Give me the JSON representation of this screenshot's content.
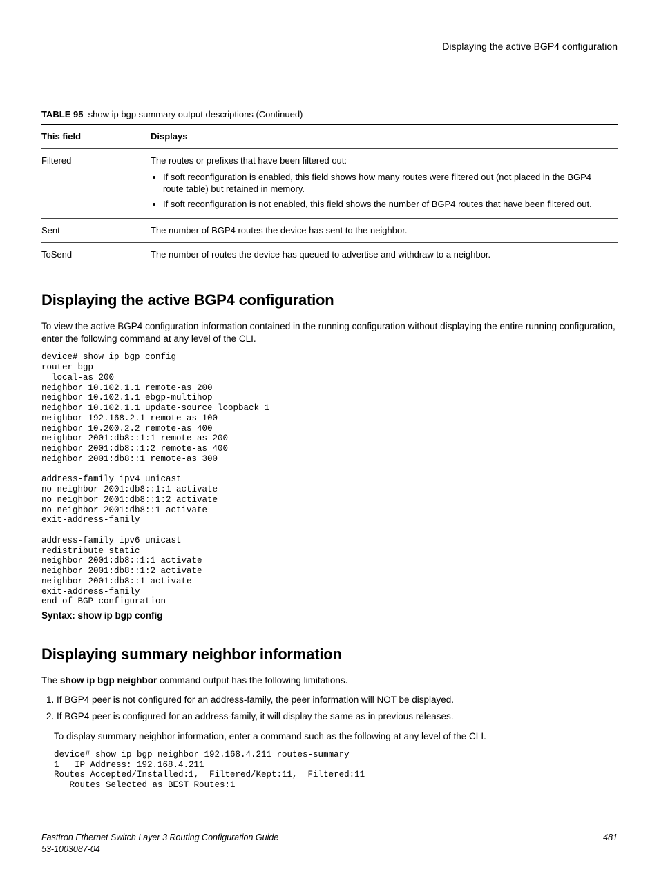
{
  "header": {
    "right": "Displaying the active BGP4 configuration"
  },
  "table": {
    "caption_label": "TABLE 95",
    "caption_text": "show ip bgp summary output descriptions (Continued)",
    "col1": "This field",
    "col2": "Displays",
    "rows": {
      "filtered": {
        "field": "Filtered",
        "intro": "The routes or prefixes that have been filtered out:",
        "b1": "If soft reconfiguration is enabled, this field shows how many routes were filtered out (not placed in the BGP4 route table) but retained in memory.",
        "b2": "If soft reconfiguration is not enabled, this field shows the number of BGP4 routes that have been filtered out."
      },
      "sent": {
        "field": "Sent",
        "desc": "The number of BGP4 routes the device has sent to the neighbor."
      },
      "tosend": {
        "field": "ToSend",
        "desc": "The number of routes the device has queued to advertise and withdraw to a neighbor."
      }
    }
  },
  "section1": {
    "heading": "Displaying the active BGP4 configuration",
    "para": "To view the active BGP4 configuration information contained in the running configuration without displaying the entire running configuration, enter the following command at any level of the CLI.",
    "code": "device# show ip bgp config\nrouter bgp\n  local-as 200\nneighbor 10.102.1.1 remote-as 200\nneighbor 10.102.1.1 ebgp-multihop\nneighbor 10.102.1.1 update-source loopback 1\nneighbor 192.168.2.1 remote-as 100\nneighbor 10.200.2.2 remote-as 400\nneighbor 2001:db8::1:1 remote-as 200\nneighbor 2001:db8::1:2 remote-as 400\nneighbor 2001:db8::1 remote-as 300\n\naddress-family ipv4 unicast\nno neighbor 2001:db8::1:1 activate\nno neighbor 2001:db8::1:2 activate\nno neighbor 2001:db8::1 activate\nexit-address-family\n\naddress-family ipv6 unicast\nredistribute static\nneighbor 2001:db8::1:1 activate\nneighbor 2001:db8::1:2 activate\nneighbor 2001:db8::1 activate\nexit-address-family\nend of BGP configuration",
    "syntax": "Syntax: show ip bgp config"
  },
  "section2": {
    "heading": "Displaying summary neighbor information",
    "para_pre": "The ",
    "para_cmd": "show ip bgp neighbor",
    "para_post": " command output has the following limitations.",
    "li1": "If BGP4 peer is not configured for an address-family, the peer information will NOT be displayed.",
    "li2": "If BGP4 peer is configured for an address-family, it will display the same as in previous releases.",
    "indented": "To display summary neighbor information, enter a command such as the following at any level of the CLI.",
    "code": "device# show ip bgp neighbor 192.168.4.211 routes-summary\n1   IP Address: 192.168.4.211\nRoutes Accepted/Installed:1,  Filtered/Kept:11,  Filtered:11\n   Routes Selected as BEST Routes:1"
  },
  "footer": {
    "title": "FastIron Ethernet Switch Layer 3 Routing Configuration Guide",
    "docnum": "53-1003087-04",
    "page": "481"
  }
}
